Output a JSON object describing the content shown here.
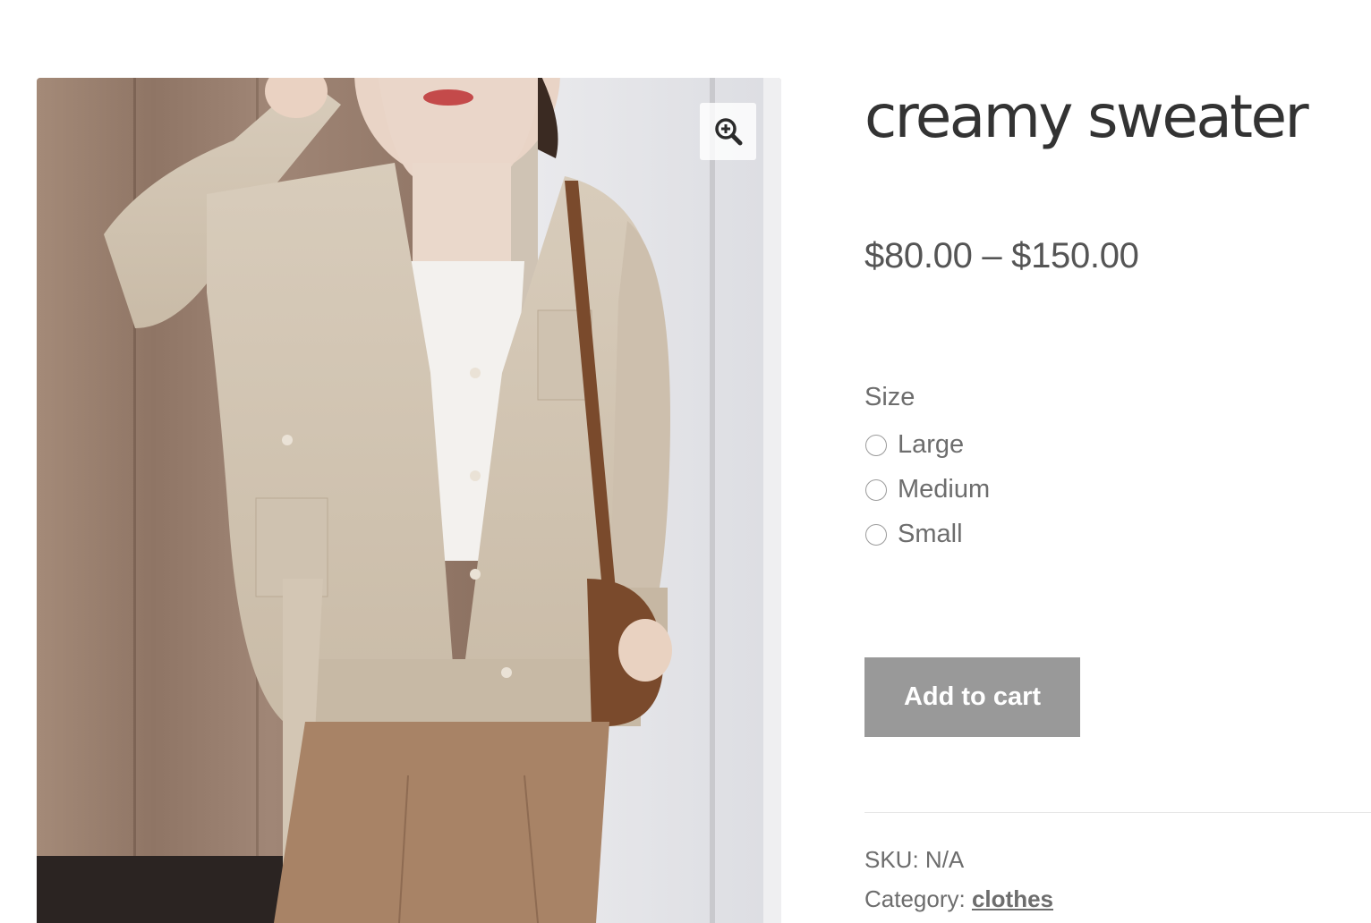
{
  "gallery": {
    "zoom_icon": "magnifier-plus-icon",
    "image_alt": "Woman wearing a creamy beige knit cardigan with white top and camel trousers"
  },
  "product": {
    "title": "creamy sweater",
    "price_range": "$80.00 – $150.00"
  },
  "variations": {
    "label": "Size",
    "options": [
      {
        "label": "Large",
        "selected": false
      },
      {
        "label": "Medium",
        "selected": false
      },
      {
        "label": "Small",
        "selected": false
      }
    ]
  },
  "actions": {
    "add_to_cart_label": "Add to cart"
  },
  "meta": {
    "sku_label": "SKU:",
    "sku_value": "N/A",
    "category_label": "Category:",
    "category_value": "clothes"
  },
  "colors": {
    "title_text": "#333333",
    "body_text": "#6d6d6d",
    "button_bg": "#999999",
    "button_text": "#ffffff"
  }
}
